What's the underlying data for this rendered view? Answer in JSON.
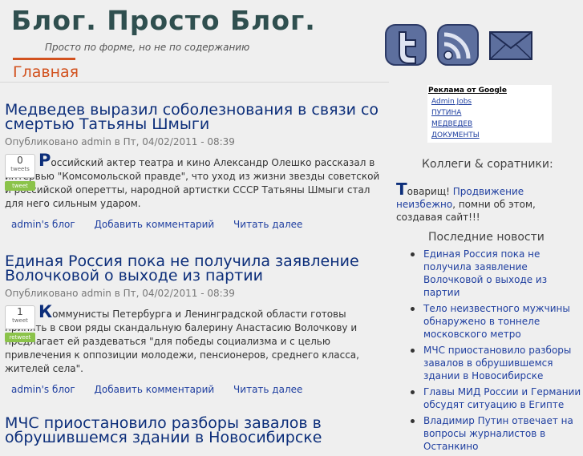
{
  "header": {
    "site_title": "Блог. Просто Блог.",
    "slogan": "Просто по форме, но не по содержанию",
    "nav_home": "Главная",
    "social": [
      "twitter-icon",
      "rss-icon",
      "mail-icon"
    ]
  },
  "colors": {
    "title": "#2f4f4f",
    "nav": "#d2521f",
    "link": "#1f3fa0",
    "heading": "#0c2e7a"
  },
  "posts": [
    {
      "title": "Медведев выразил соболезнования в связи со смертью Татьяны Шмыги",
      "submitted": "Опубликовано admin в Пт, 04/02/2011 - 08:39",
      "tweet_count": "0",
      "tweet_unit": "tweets",
      "tweet_button": "tweet",
      "dropcap": "Р",
      "body": "оссийский актер театра и кино Александр Олешко рассказал в интервью \"Комсомольской правде\", что уход из жизни звезды советской и российской оперетты, народной артистки СССР Татьяны Шмыги стал для него сильным ударом.",
      "link_blog": "admin's блог",
      "link_comment": "Добавить комментарий",
      "link_more": "Читать далее"
    },
    {
      "title": "Единая Россия пока не получила заявление Волочковой о выходе из партии",
      "submitted": "Опубликовано admin в Пт, 04/02/2011 - 08:39",
      "tweet_count": "1",
      "tweet_unit": "tweet",
      "tweet_button": "retweet",
      "dropcap": "К",
      "body": "оммунисты Петербурга и Ленинградской области готовы принять в свои ряды скандальную балерину Анастасию Волочкову и предлагает ей раздеваться \"для победы социализма и с целью привлечения к оппозиции молодежи, пенсионеров, среднего класса, жителей села\".",
      "link_blog": "admin's блог",
      "link_comment": "Добавить комментарий",
      "link_more": "Читать далее"
    },
    {
      "title": "МЧС приостановило разборы завалов в обрушившемся здании в Новосибирске"
    }
  ],
  "ads": {
    "heading": "Реклама от Google",
    "items": [
      "Admin Jobs",
      "ПУТИНА",
      "МЕДВЕДЕВ",
      "ДОКУМЕНТЫ"
    ]
  },
  "colleagues": {
    "title": "Коллеги & соратники:",
    "dropcap": "Т",
    "pre": "оварищ! ",
    "link": "Продвижение неизбежно",
    "post": ", помни об этом, создавая сайт!!!"
  },
  "news": {
    "title": "Последние новости",
    "items": [
      "Единая Россия пока не получила заявление Волочковой о выходе из партии",
      "Тело неизвестного мужчины обнаружено в тоннеле московского метро",
      "МЧС приостановило разборы завалов в обрушившемся здании в Новосибирске",
      "Главы МИД России и Германии обсудят ситуацию в Египте",
      "Владимир Путин отвечает на вопросы журналистов в Останкино"
    ]
  }
}
